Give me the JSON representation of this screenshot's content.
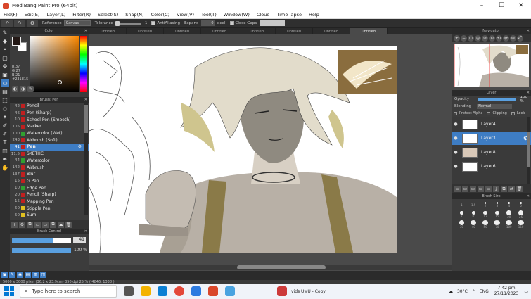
{
  "window": {
    "title": "MediBang Paint Pro (64bit)",
    "minimize": "–",
    "maximize": "☐",
    "close": "✕"
  },
  "menu": [
    "File(F)",
    "Edit(E)",
    "Layer(L)",
    "Filter(R)",
    "Select(S)",
    "Snap(N)",
    "Color(C)",
    "View(V)",
    "Tool(T)",
    "Window(W)",
    "Cloud",
    "Time-lapse",
    "Help"
  ],
  "toolbar": {
    "reference_label": "Reference",
    "reference_value": "Canvas",
    "tolerance_label": "Tolerance",
    "tolerance_value": "1",
    "antialias_label": "AntiAliasing",
    "expand_label": "Expand",
    "expand_value": "0",
    "expand_unit": "pixel",
    "close_gaps_label": "Close Gaps"
  },
  "tabs": [
    "Untitled",
    "Untitled",
    "Untitled",
    "Untitled",
    "Untitled",
    "Untitled",
    "Untitled",
    "Untitled"
  ],
  "color": {
    "title": "Color",
    "r": "R:37",
    "g": "G:27",
    "b": "B:21",
    "hex": "#231815",
    "fg": "#231815"
  },
  "brush_panel": {
    "title": "Brush: Pen",
    "items": [
      {
        "size": "42",
        "name": "Pencil",
        "color": "#c02020"
      },
      {
        "size": "46",
        "name": "Pen (Sharp)",
        "color": "#c02020"
      },
      {
        "size": "10",
        "name": "School Pen (Smooth)",
        "color": "#c02020"
      },
      {
        "size": "105",
        "name": "Marker",
        "color": "#c02020"
      },
      {
        "size": "100",
        "name": "Watercolor (Wet)",
        "color": "#30a030"
      },
      {
        "size": "243",
        "name": "Airbrush (Soft)",
        "color": "#c02020"
      },
      {
        "size": "41",
        "name": "Pen",
        "color": "#c02020"
      },
      {
        "size": "11.5",
        "name": "SKETHC",
        "color": "#c02020"
      },
      {
        "size": "44",
        "name": "Watercolor",
        "color": "#30a030"
      },
      {
        "size": "142",
        "name": "Airbrush",
        "color": "#c02020"
      },
      {
        "size": "137",
        "name": "Blur",
        "color": "#c02020"
      },
      {
        "size": "15",
        "name": "G Pen",
        "color": "#c02020"
      },
      {
        "size": "10",
        "name": "Edge Pen",
        "color": "#30a030"
      },
      {
        "size": "20",
        "name": "Pencil (Sharp)",
        "color": "#c02020"
      },
      {
        "size": "15",
        "name": "Mapping Pen",
        "color": "#c02020"
      },
      {
        "size": "50",
        "name": "Stipple Pen",
        "color": "#e0c020"
      },
      {
        "size": "50",
        "name": "Sumi",
        "color": "#e0c020"
      }
    ],
    "active_index": 6
  },
  "brush_control": {
    "title": "Brush Control",
    "size": "41",
    "opacity": "100 %",
    "size_fraction": 0.7,
    "opacity_fraction": 1.0
  },
  "navigator": {
    "title": "Navigator"
  },
  "layer_panel": {
    "title": "Layer",
    "opacity_label": "Opacity",
    "opacity_value": "100 %",
    "blending_label": "Blending",
    "blending_value": "Normal",
    "protect_alpha": "Protect Alpha",
    "clipping": "Clipping",
    "lock": "Lock",
    "layers": [
      "Layer4",
      "Layer3",
      "Layer8",
      "Layer6"
    ],
    "active_index": 1
  },
  "brush_size": {
    "title": "Brush Size",
    "labels": [
      "1",
      "1.5",
      "2",
      "3",
      "4",
      "5",
      "7",
      "10",
      "12",
      "15",
      "20",
      "25",
      "30",
      "40",
      "50",
      "70",
      "100",
      "150"
    ]
  },
  "status": {
    "info": "5000 x 3000 pixel  (36.2 x 23.9cm)  350 dpi  25 %  ( 4846, 1338 )"
  },
  "taskbar": {
    "search_placeholder": "Type here to search",
    "app_label": "vids UwU - Copy",
    "temp": "30°C",
    "lang": "ENG",
    "time": "7:42 pm",
    "date": "27/11/2023"
  }
}
